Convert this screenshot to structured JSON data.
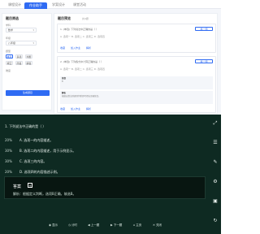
{
  "app": {
    "tabs": [
      "课程设计",
      "作业助手",
      "学案设计",
      "课堂活动"
    ],
    "active_tab": 1,
    "left": {
      "title": "题目筛选",
      "subject_label": "学科",
      "subject_value": "数学",
      "grade_label": "年级",
      "grade_value": "八年级",
      "type_label": "题型",
      "difficulty_label": "难度",
      "chips": [
        "单选",
        "多选",
        "判断",
        "填空",
        "简答",
        "解答"
      ],
      "generate_label": "生成题目"
    },
    "main": {
      "title": "题目预览",
      "count": "共4题",
      "cards": [
        {
          "line": "1. (单选) 下列说法中正确的是（ ）",
          "opts": "A. 选项一    B. 选项二    C. 选项三    D. 选项四",
          "button": "换一题",
          "actions": [
            "收藏",
            "加入作业",
            "解析"
          ]
        },
        {
          "line": "2. (单选) 下列各式中计算正确的是（ ）",
          "opts": "A. 选项一    B. 选项二    C. 选项三    D. 选项四",
          "button": "换一题",
          "answer_label": "答案",
          "answer_text": "B",
          "analysis_label": "解析",
          "analysis_text": "根据运算法则逐项判断即可得出正确答案。",
          "actions": [
            "收藏",
            "加入作业",
            "解析"
          ]
        }
      ]
    }
  },
  "viewer": {
    "question": "1. 下列说法中正确的是（ ）",
    "options": [
      {
        "tag": "20%",
        "text": "A. 选项一的内容描述。"
      },
      {
        "tag": "30%",
        "text": "B. 选项二的内容描述，用于示例显示。"
      },
      {
        "tag": "30%",
        "text": "C. 选项三的内容。"
      },
      {
        "tag": "20%",
        "text": "D. 选项四的内容描述示例。"
      }
    ],
    "answer_title": "答案",
    "answer_icon": "[+]",
    "answer_text": "解析：根据定义判断，选项B正确，故选B。",
    "toolbar": [
      "⤢",
      "☰",
      "✎",
      "⚙",
      "▣",
      "↻"
    ],
    "bottom": [
      {
        "icon": "◉",
        "label": "显示"
      },
      {
        "icon": "◷",
        "label": "计时"
      },
      {
        "icon": "◀",
        "label": "上一题"
      },
      {
        "icon": "▶",
        "label": "下一题"
      },
      {
        "icon": "⌂",
        "label": "主页"
      },
      {
        "icon": "✕",
        "label": "关闭"
      }
    ]
  },
  "colors": {
    "accent": "#2f6bf3",
    "viewer_bg": "#0e2a22",
    "answer_bg": "#081611"
  }
}
